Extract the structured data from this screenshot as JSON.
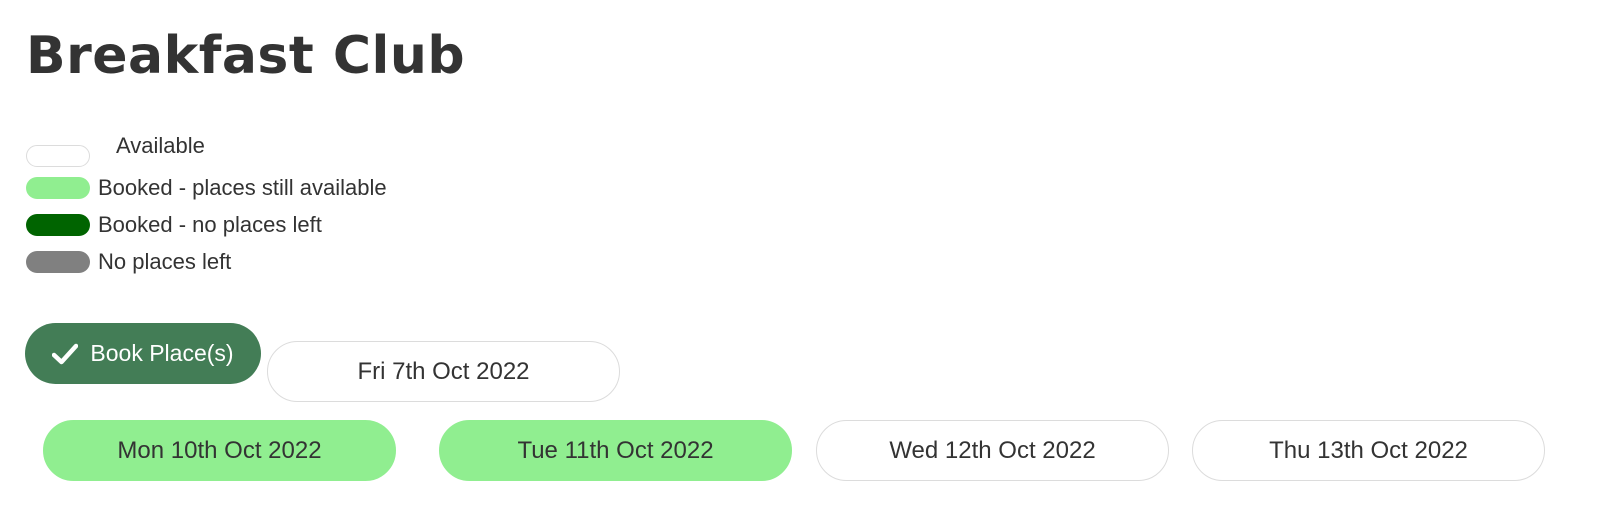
{
  "page": {
    "title": "Breakfast Club"
  },
  "colors": {
    "available": "#ffffff",
    "booked_places_available": "#90ee90",
    "booked_no_places": "#006400",
    "no_places": "#808080",
    "book_button": "#437d56"
  },
  "legend": [
    {
      "label": "Available",
      "color": "#ffffff"
    },
    {
      "label": "Booked - places still available",
      "color": "#90ee90"
    },
    {
      "label": "Booked - no places left",
      "color": "#006400"
    },
    {
      "label": "No places left",
      "color": "#808080"
    }
  ],
  "actions": {
    "book_label": "Book Place(s)",
    "book_icon": "check-icon"
  },
  "days": [
    {
      "label": "Fri 7th Oct 2022",
      "status": "available",
      "color": "#ffffff"
    },
    {
      "label": "Mon 10th Oct 2022",
      "status": "booked - places still available",
      "color": "#90ee90"
    },
    {
      "label": "Tue 11th Oct 2022",
      "status": "booked - places still available",
      "color": "#90ee90"
    },
    {
      "label": "Wed 12th Oct 2022",
      "status": "available",
      "color": "#ffffff"
    },
    {
      "label": "Thu 13th Oct 2022",
      "status": "available",
      "color": "#ffffff"
    }
  ]
}
